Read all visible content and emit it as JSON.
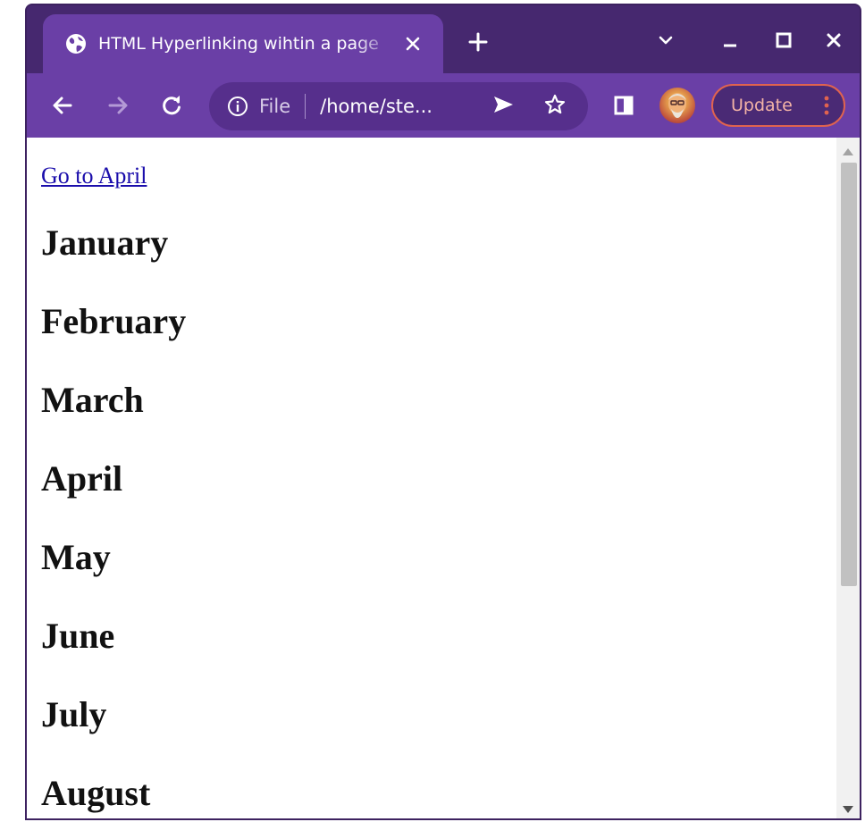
{
  "browser": {
    "tab_title": "HTML Hyperlinking wihtin a page",
    "omnibox": {
      "scheme": "File",
      "url": "/home/ste..."
    },
    "update_label": "Update",
    "colors": {
      "frame": "#46286f",
      "toolbar": "#6a3fa6",
      "omnibox": "#562f8c",
      "update_border": "#e0634f"
    }
  },
  "icons": {
    "favicon": "globe-icon",
    "tab_close": "close-icon",
    "new_tab": "plus-icon",
    "tab_search": "chevron-down-icon",
    "minimize": "minimize-icon",
    "maximize": "maximize-icon",
    "close_window": "close-icon",
    "back": "arrow-left-icon",
    "forward": "arrow-right-icon",
    "reload": "reload-icon",
    "site_info": "info-icon",
    "send": "send-icon",
    "bookmark": "star-icon",
    "side_panel": "side-panel-icon",
    "menu": "kebab-menu-icon"
  },
  "page": {
    "link_text": "Go to April",
    "link_color": "#1a0dab",
    "months": [
      "January",
      "February",
      "March",
      "April",
      "May",
      "June",
      "July",
      "August"
    ]
  }
}
